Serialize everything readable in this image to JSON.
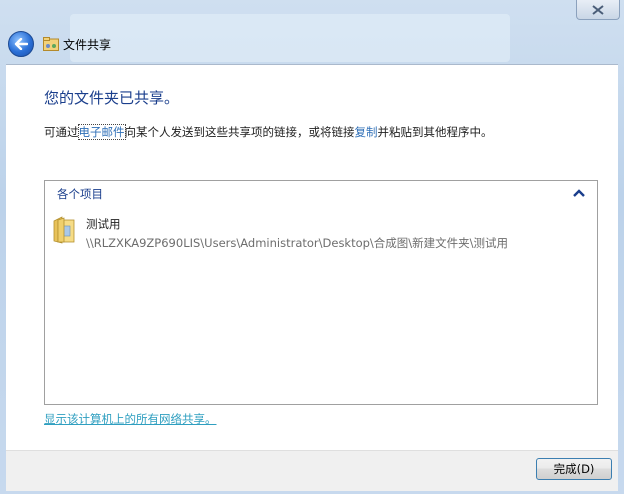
{
  "window": {
    "title": "文件共享",
    "close_icon": "close-icon",
    "back_icon": "back-arrow-icon"
  },
  "main": {
    "heading": "您的文件夹已共享。",
    "description": {
      "part1": "可通过",
      "email_link": "电子邮件",
      "part2": "向某个人发送到这些共享项的链接，或将链接",
      "copy_link": "复制",
      "part3": "并粘贴到其他程序中。"
    },
    "list": {
      "group_header": "各个项目",
      "items": [
        {
          "name": "测试用",
          "path": "\\\\RLZXKA9ZP690LIS\\Users\\Administrator\\Desktop\\合成图\\新建文件夹\\测试用",
          "icon": "shared-folder-icon"
        }
      ]
    },
    "show_all_link": "显示该计算机上的所有网络共享。"
  },
  "footer": {
    "done_button": "完成(D)"
  },
  "colors": {
    "heading": "#1a3e8c",
    "link": "#2f6fb7",
    "show_all_link": "#2f9fc0",
    "path_text": "#6d6d6d"
  }
}
